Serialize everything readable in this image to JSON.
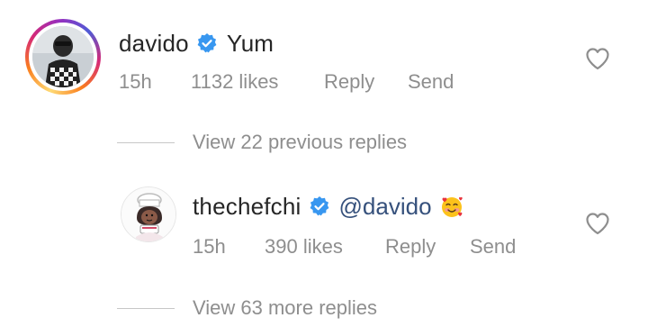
{
  "comments": [
    {
      "username": "davido",
      "text": "Yum",
      "time": "15h",
      "likes": "1132 likes",
      "reply": "Reply",
      "send": "Send"
    },
    {
      "username": "thechefchi",
      "mention": "@davido",
      "emoji": "smiling-face-with-hearts",
      "time": "15h",
      "likes": "390 likes",
      "reply": "Reply",
      "send": "Send"
    }
  ],
  "view_previous": "View 22 previous replies",
  "view_more": "View 63 more replies",
  "colors": {
    "text": "#262626",
    "muted": "#8e8e8e",
    "mention": "#36517c",
    "verified": "#3897f0"
  }
}
